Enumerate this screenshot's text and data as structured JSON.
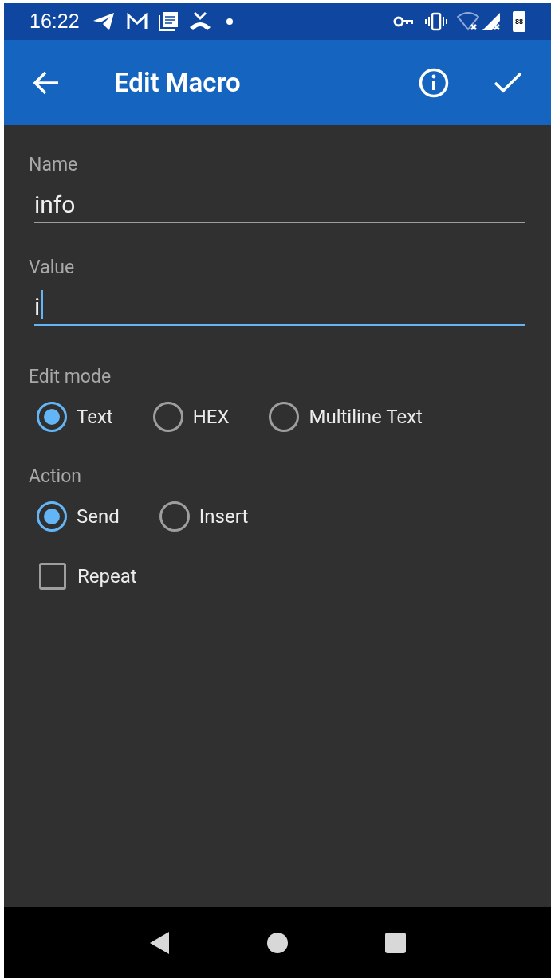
{
  "status_bar": {
    "time": "16:22",
    "battery": "88"
  },
  "app_bar": {
    "title": "Edit Macro"
  },
  "fields": [
    {
      "label": "Name",
      "value": "info",
      "focused": false
    },
    {
      "label": "Value",
      "value": "i",
      "focused": true
    }
  ],
  "edit_mode": {
    "label": "Edit mode",
    "options": [
      {
        "label": "Text",
        "selected": true
      },
      {
        "label": "HEX",
        "selected": false
      },
      {
        "label": "Multiline Text",
        "selected": false
      }
    ]
  },
  "action": {
    "label": "Action",
    "options": [
      {
        "label": "Send",
        "selected": true
      },
      {
        "label": "Insert",
        "selected": false
      }
    ]
  },
  "repeat": {
    "label": "Repeat",
    "checked": false
  }
}
